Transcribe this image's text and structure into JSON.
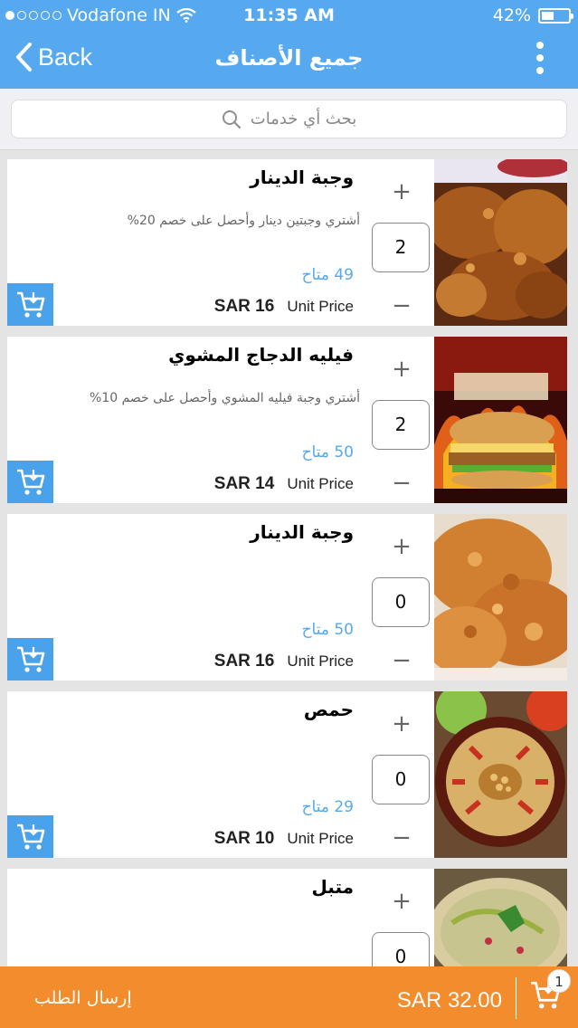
{
  "status_bar": {
    "carrier": "Vodafone IN",
    "time": "11:35 AM",
    "battery": "42%"
  },
  "nav": {
    "back_label": "Back",
    "title": "جميع الأصناف"
  },
  "search": {
    "placeholder": "بحث أي خدمات"
  },
  "items": [
    {
      "title": "وجبة الدينار",
      "description": "أشتري وجبتين دينار وأحصل على خصم 20%",
      "stock": "49 متاح",
      "price": "SAR 16",
      "unit_label": "Unit Price",
      "quantity": "2",
      "image": "fried-chicken"
    },
    {
      "title": "فيليه الدجاج المشوي",
      "description": "أشتري وجبة فيليه المشوي وأحصل على خصم 10%",
      "stock": "50 متاح",
      "price": "SAR 14",
      "unit_label": "Unit Price",
      "quantity": "2",
      "image": "chicken-burger"
    },
    {
      "title": "وجبة الدينار",
      "description": "",
      "stock": "50 متاح",
      "price": "SAR 16",
      "unit_label": "Unit Price",
      "quantity": "0",
      "image": "fried-chicken-pieces"
    },
    {
      "title": "حمص",
      "description": "",
      "stock": "29 متاح",
      "price": "SAR 10",
      "unit_label": "Unit Price",
      "quantity": "0",
      "image": "hummus"
    },
    {
      "title": "متبل",
      "description": "",
      "stock": "",
      "price": "",
      "unit_label": "",
      "quantity": "0",
      "image": "mutabbal"
    }
  ],
  "bottom_bar": {
    "submit_label": "إرسال الطلب",
    "total": "SAR 32.00",
    "cart_count": "1"
  },
  "colors": {
    "accent": "#56a9ee",
    "cart_button": "#4aa2eb",
    "bottom_bar": "#f28c2c"
  }
}
